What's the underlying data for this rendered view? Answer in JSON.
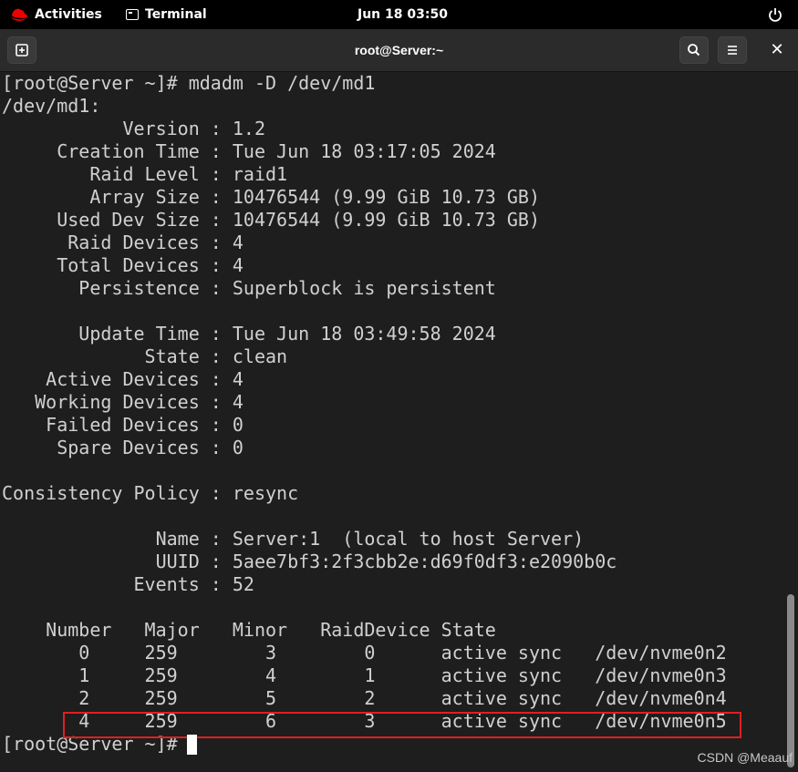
{
  "topbar": {
    "activities_label": "Activities",
    "app_label": "Terminal",
    "clock": "Jun 18  03:50"
  },
  "window": {
    "title": "root@Server:~"
  },
  "terminal": {
    "lines": [
      "[root@Server ~]# mdadm -D /dev/md1",
      "/dev/md1:",
      "           Version : 1.2",
      "     Creation Time : Tue Jun 18 03:17:05 2024",
      "        Raid Level : raid1",
      "        Array Size : 10476544 (9.99 GiB 10.73 GB)",
      "     Used Dev Size : 10476544 (9.99 GiB 10.73 GB)",
      "      Raid Devices : 4",
      "     Total Devices : 4",
      "       Persistence : Superblock is persistent",
      "",
      "       Update Time : Tue Jun 18 03:49:58 2024",
      "             State : clean",
      "    Active Devices : 4",
      "   Working Devices : 4",
      "    Failed Devices : 0",
      "     Spare Devices : 0",
      "",
      "Consistency Policy : resync",
      "",
      "              Name : Server:1  (local to host Server)",
      "              UUID : 5aee7bf3:2f3cbb2e:d69f0df3:e2090b0c",
      "            Events : 52",
      "",
      "    Number   Major   Minor   RaidDevice State",
      "       0     259        3        0      active sync   /dev/nvme0n2",
      "       1     259        4        1      active sync   /dev/nvme0n3",
      "       2     259        5        2      active sync   /dev/nvme0n4",
      "       4     259        6        3      active sync   /dev/nvme0n5",
      "[root@Server ~]# "
    ]
  },
  "watermark": "CSDN @Meaauf",
  "colors": {
    "terminal_bg": "#1e1e1e",
    "terminal_fg": "#d0d0d0",
    "highlight_border": "#e02020",
    "topbar_bg": "#000000"
  }
}
